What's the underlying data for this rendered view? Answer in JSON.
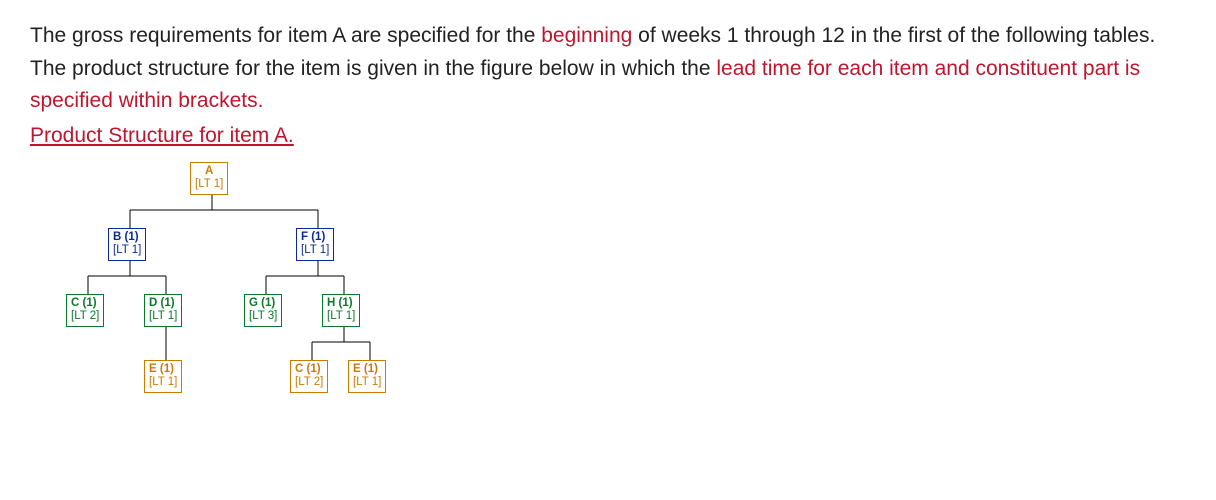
{
  "paragraph": {
    "t1": "The gross requirements for item A are specified for the ",
    "t2": "beginning",
    "t3": " of weeks 1 through 12 in the first of the following tables.   The product structure for the item is given in the figure below in which the ",
    "t4": "lead time for each item and constituent part is specified within brackets.",
    "title": "Product Structure for item A."
  },
  "nodes": {
    "A": {
      "label": "A",
      "lt": "[LT 1]"
    },
    "B": {
      "label": "B (1)",
      "lt": "[LT 1]"
    },
    "F": {
      "label": "F (1)",
      "lt": "[LT 1]"
    },
    "C": {
      "label": "C (1)",
      "lt": "[LT 2]"
    },
    "D": {
      "label": "D (1)",
      "lt": "[LT 1]"
    },
    "G": {
      "label": "G (1)",
      "lt": "[LT 3]"
    },
    "H": {
      "label": "H (1)",
      "lt": "[LT 1]"
    },
    "E": {
      "label": "E (1)",
      "lt": "[LT 1]"
    },
    "HC": {
      "label": "C (1)",
      "lt": "[LT 2]"
    },
    "HE": {
      "label": "E (1)",
      "lt": "[LT 1]"
    }
  }
}
